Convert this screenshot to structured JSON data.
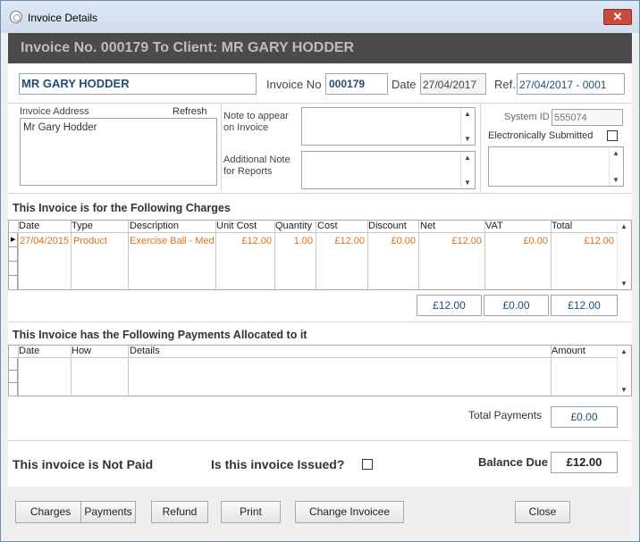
{
  "window": {
    "title": "Invoice Details"
  },
  "header": {
    "title": "Invoice No. 000179 To Client: MR GARY HODDER"
  },
  "top": {
    "client_name": "MR GARY HODDER",
    "invoice_no_label": "Invoice No",
    "invoice_no": "000179",
    "date_label": "Date",
    "date": "27/04/2017",
    "ref_label": "Ref.",
    "ref": "27/04/2017 - 0001"
  },
  "address": {
    "label": "Invoice Address",
    "refresh": "Refresh",
    "value": "Mr Gary Hodder"
  },
  "notes": {
    "note_label_1": "Note to appear",
    "note_label_2": "on Invoice",
    "additional_label_1": "Additional Note",
    "additional_label_2": "for Reports"
  },
  "system": {
    "id_label": "System ID",
    "id_value": "555074",
    "electronic_label": "Electronically Submitted"
  },
  "charges": {
    "title": "This Invoice is for the Following Charges",
    "columns": [
      "Date",
      "Type",
      "Description",
      "Unit Cost",
      "Quantity",
      "Cost",
      "Discount",
      "Net",
      "VAT",
      "Total"
    ],
    "rows": [
      {
        "date": "27/04/2015",
        "type": "Product",
        "description": "Exercise Ball - Med",
        "unit_cost": "£12.00",
        "quantity": "1.00",
        "cost": "£12.00",
        "discount": "£0.00",
        "net": "£12.00",
        "vat": "£0.00",
        "total": "£12.00"
      }
    ],
    "totals": {
      "net": "£12.00",
      "vat": "£0.00",
      "total": "£12.00"
    }
  },
  "payments": {
    "title": "This Invoice has the Following Payments Allocated to it",
    "columns": [
      "Date",
      "How",
      "Details",
      "Amount"
    ],
    "total_label": "Total Payments",
    "total_value": "£0.00"
  },
  "status": {
    "paid_text": "This invoice is Not Paid",
    "issued_label": "Is this invoice Issued?",
    "balance_label": "Balance Due",
    "balance_value": "£12.00"
  },
  "buttons": {
    "charges": "Charges",
    "payments": "Payments",
    "refund": "Refund",
    "print": "Print",
    "change_invoicee": "Change Invoicee",
    "close": "Close"
  },
  "colors": {
    "header_band": "#4b4b4b",
    "accent_text": "#1f4e79",
    "charge_text": "#e07014",
    "close_button": "#c94b3f"
  }
}
